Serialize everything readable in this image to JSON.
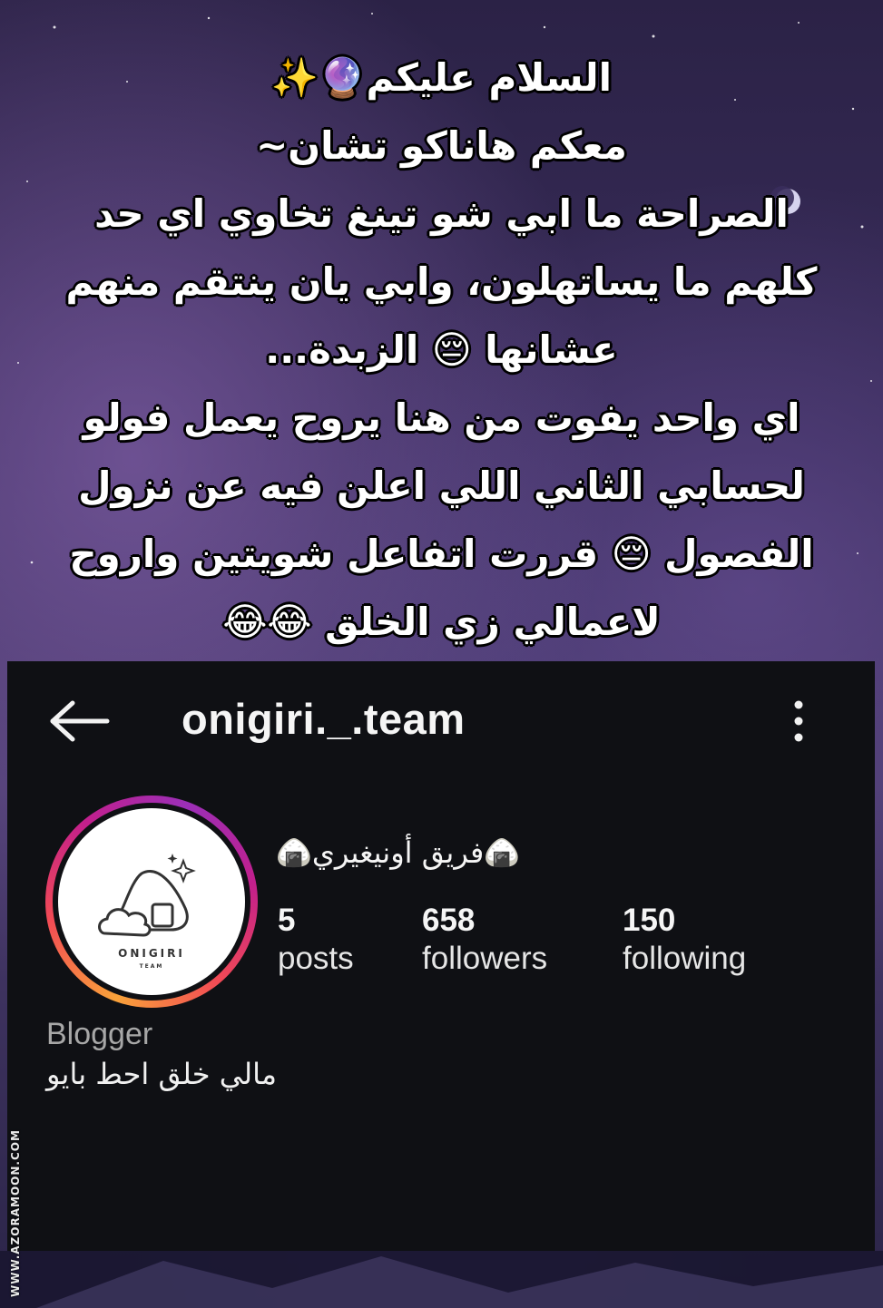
{
  "caption": {
    "lines": [
      "السلام عليكم🔮✨",
      "معكم هاناكو تشان~",
      "الصراحة ما ابي شو تينغ تخاوي اي حد",
      "كلهم ما يساتهلون، وابي يان ينتقم منهم",
      "عشانها 😔 الزبدة...",
      "اي واحد يفوت من هنا يروح يعمل فولو",
      "لحسابي الثاني اللي اعلن فيه عن نزول",
      "الفصول 😔 قررت اتفاعل شويتين واروح",
      "لاعمالي زي الخلق 😂😂"
    ]
  },
  "profile": {
    "username": "onigiri._.team",
    "display_name": "🍙فريق أونيغيري🍙",
    "avatar_text": "ONIGIRI",
    "avatar_subtext": "TEAM",
    "stats": [
      {
        "value": "5",
        "label": "posts"
      },
      {
        "value": "658",
        "label": "followers"
      },
      {
        "value": "150",
        "label": "following"
      }
    ],
    "category": "Blogger",
    "bio": "مالي خلق احط بايو"
  },
  "icons": {
    "back": "back-arrow-icon",
    "menu": "more-vertical-icon"
  },
  "watermark": "WWW.AZORAMOON.COM",
  "colors": {
    "panel_bg": "#0f1014",
    "ring_start": "#f9a23a",
    "ring_mid": "#f24a55",
    "ring_end": "#c21f8c"
  }
}
